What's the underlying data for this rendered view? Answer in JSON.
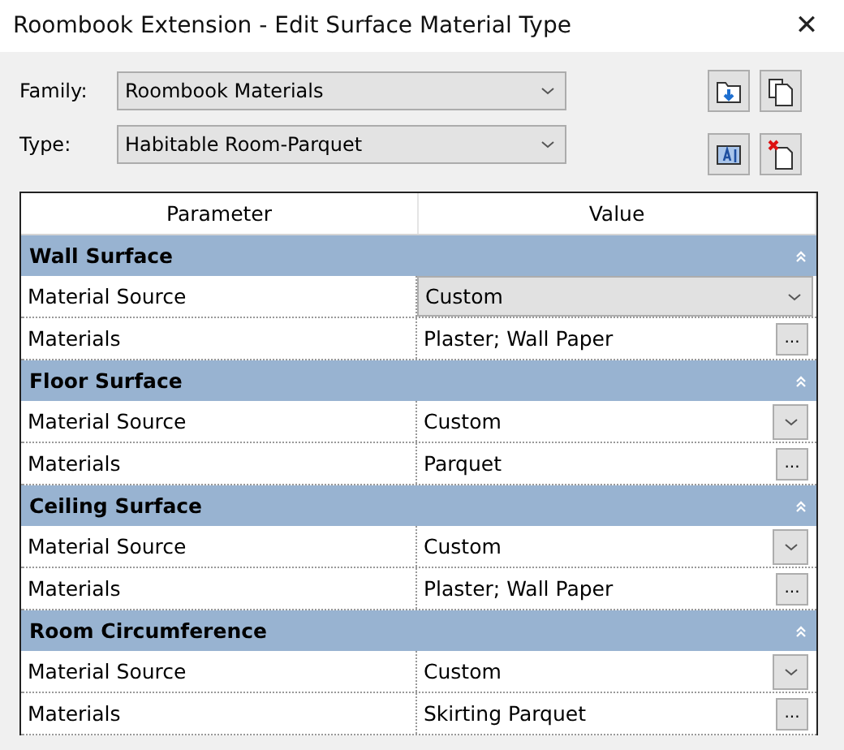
{
  "window": {
    "title": "Roombook Extension - Edit Surface Material Type",
    "close": "✕"
  },
  "fields": [
    {
      "label": "Family:",
      "value": "Roombook Materials"
    },
    {
      "label": "Type:",
      "value": "Habitable Room-Parquet"
    }
  ],
  "grid": {
    "columns": [
      "Parameter",
      "Value"
    ],
    "groups": [
      {
        "title": "Wall Surface",
        "expanded": true,
        "rows": [
          {
            "kind": "dropdown",
            "parameter": "Material Source",
            "value": "Custom",
            "selected": true
          },
          {
            "kind": "browse",
            "parameter": "Materials",
            "value": "Plaster; Wall Paper",
            "button": "...",
            "selected": false
          }
        ]
      },
      {
        "title": "Floor Surface",
        "expanded": true,
        "rows": [
          {
            "kind": "dropdown",
            "parameter": "Material Source",
            "value": "Custom",
            "selected": false
          },
          {
            "kind": "browse",
            "parameter": "Materials",
            "value": "Parquet",
            "button": "...",
            "selected": false
          }
        ]
      },
      {
        "title": "Ceiling Surface",
        "expanded": true,
        "rows": [
          {
            "kind": "dropdown",
            "parameter": "Material Source",
            "value": "Custom",
            "selected": false
          },
          {
            "kind": "browse",
            "parameter": "Materials",
            "value": "Plaster; Wall Paper",
            "button": "...",
            "selected": false
          }
        ]
      },
      {
        "title": "Room Circumference",
        "expanded": true,
        "rows": [
          {
            "kind": "dropdown",
            "parameter": "Material Source",
            "value": "Custom",
            "selected": false
          },
          {
            "kind": "browse",
            "parameter": "Materials",
            "value": "Skirting Parquet",
            "button": "...",
            "selected": false
          }
        ]
      }
    ]
  }
}
